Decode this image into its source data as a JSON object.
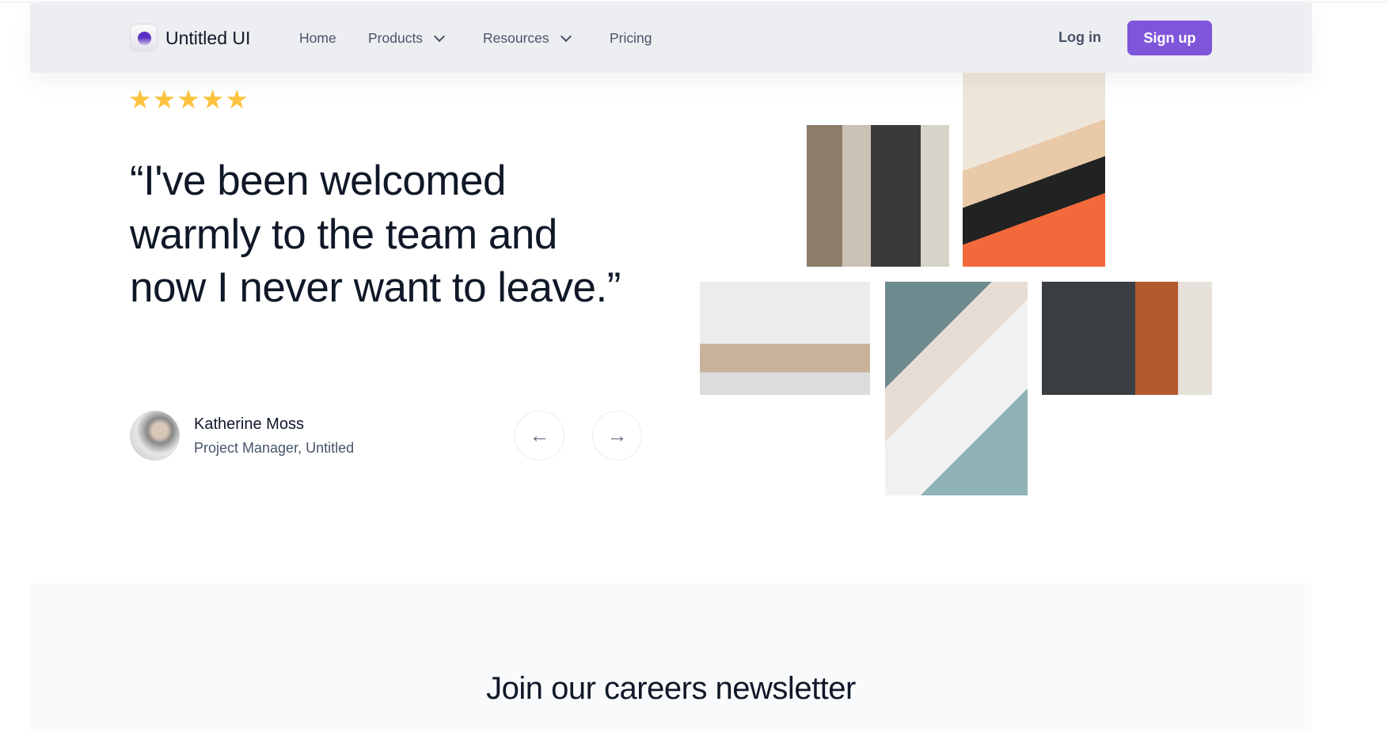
{
  "header": {
    "brand": "Untitled UI",
    "nav": [
      {
        "label": "Home",
        "has_dropdown": false
      },
      {
        "label": "Products",
        "has_dropdown": true
      },
      {
        "label": "Resources",
        "has_dropdown": true
      },
      {
        "label": "Pricing",
        "has_dropdown": false
      }
    ],
    "login_label": "Log in",
    "signup_label": "Sign up",
    "accent_color": "#7f56d9"
  },
  "testimonial": {
    "rating": 5,
    "stars": "★★★★★",
    "quote": "“I've been welcomed warmly to the team and now I never want to leave.”",
    "author_name": "Katherine Moss",
    "author_role": "Project Manager, Untitled",
    "prev_icon": "arrow-left-icon",
    "next_icon": "arrow-right-icon"
  },
  "newsletter": {
    "heading": "Join our careers newsletter"
  }
}
